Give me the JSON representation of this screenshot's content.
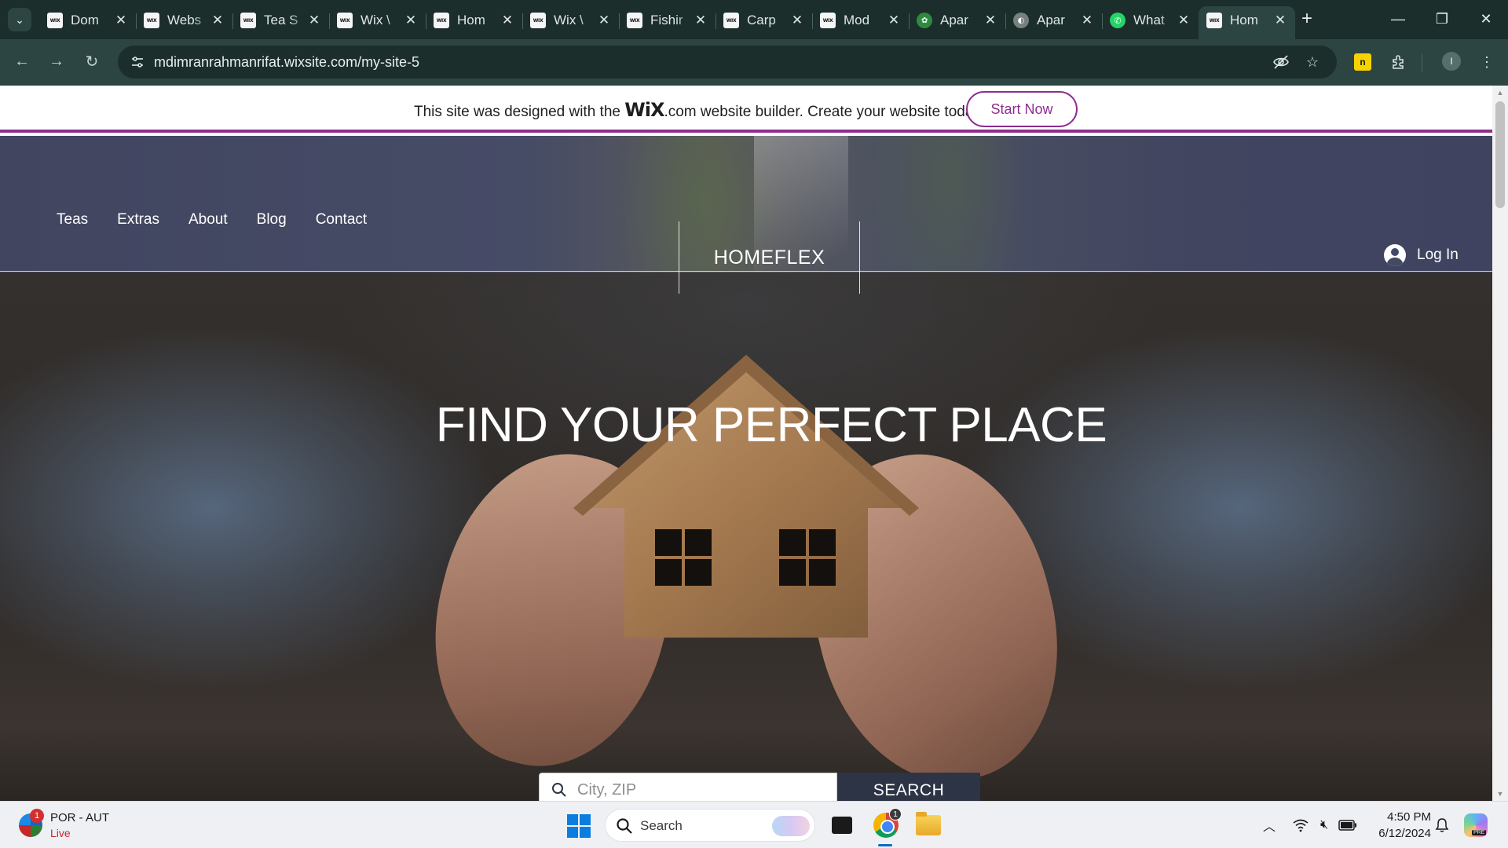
{
  "browser": {
    "tabs": [
      {
        "title": "Dom",
        "favicon": "wix",
        "active": false
      },
      {
        "title": "Webs",
        "favicon": "wix",
        "active": false
      },
      {
        "title": "Tea S",
        "favicon": "wix",
        "active": false
      },
      {
        "title": "Wix \\",
        "favicon": "wix",
        "active": false
      },
      {
        "title": "Hom",
        "favicon": "wix",
        "active": false
      },
      {
        "title": "Wix \\",
        "favicon": "wix",
        "active": false
      },
      {
        "title": "Fishir",
        "favicon": "wix",
        "active": false
      },
      {
        "title": "Carp",
        "favicon": "wix",
        "active": false
      },
      {
        "title": "Mod",
        "favicon": "wix",
        "active": false
      },
      {
        "title": "Apar",
        "favicon": "green-leaf",
        "active": false
      },
      {
        "title": "Apar",
        "favicon": "globe",
        "active": false
      },
      {
        "title": "What",
        "favicon": "whatsapp",
        "active": false
      },
      {
        "title": "Hom",
        "favicon": "wix",
        "active": true
      }
    ],
    "favicon_text": "WIX",
    "close_glyph": "✕",
    "new_tab_glyph": "+",
    "url": "mdimranrahmanrifat.wixsite.com/my-site-5",
    "profile_initial": "I",
    "extension_label": "n"
  },
  "wix_banner": {
    "text_before": "This site was designed with the ",
    "logo": "WiX",
    "logo_suffix": ".com",
    "text_after": " website builder. Create your website today.",
    "button": "Start Now",
    "accent": "#8e2d8f"
  },
  "site": {
    "nav": [
      "Teas",
      "Extras",
      "About",
      "Blog",
      "Contact"
    ],
    "brand": "HOMEFLEX",
    "login": "Log In",
    "hero_title": "FIND YOUR PERFECT PLACE",
    "search_placeholder": "City, ZIP",
    "search_button": "SEARCH",
    "header_color": "#414560",
    "button_color": "#2d3446"
  },
  "taskbar": {
    "weather_title": "POR - AUT",
    "weather_sub": "Live",
    "badge_count": "1",
    "search_label": "Search",
    "chrome_badge": "1",
    "time": "4:50 PM",
    "date": "6/12/2024",
    "copilot_tag": "PRE"
  }
}
